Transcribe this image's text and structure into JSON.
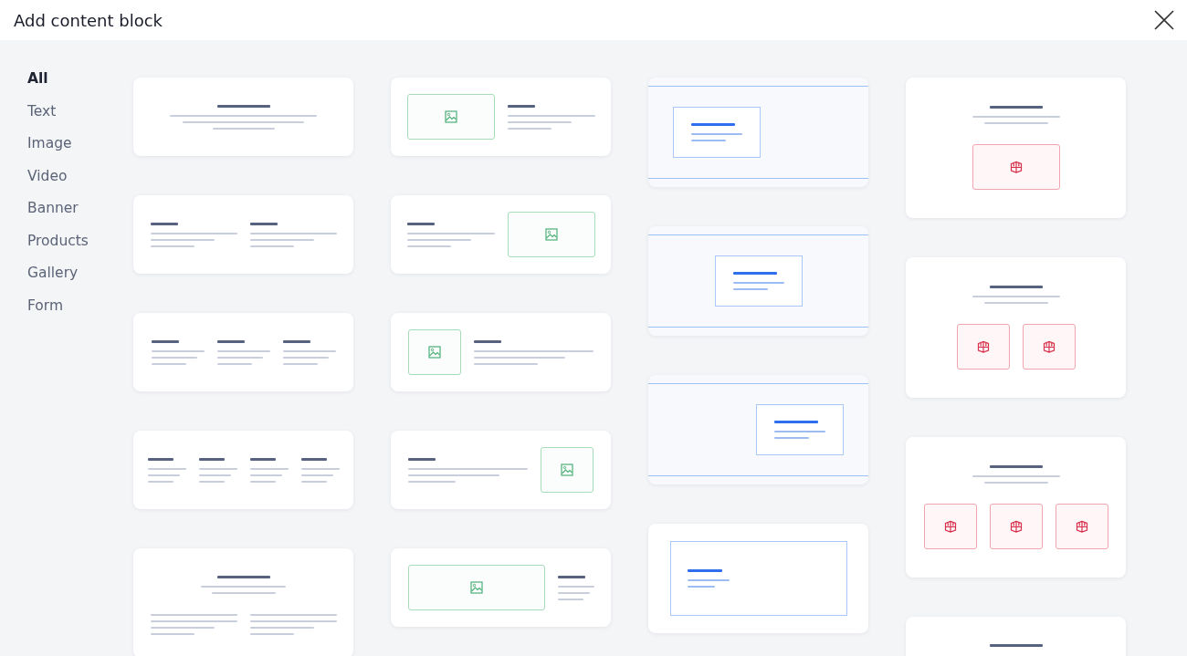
{
  "dialog": {
    "title": "Add content block"
  },
  "sidebar": {
    "items": [
      {
        "label": "All",
        "selected": true
      },
      {
        "label": "Text",
        "selected": false
      },
      {
        "label": "Image",
        "selected": false
      },
      {
        "label": "Video",
        "selected": false
      },
      {
        "label": "Banner",
        "selected": false
      },
      {
        "label": "Products",
        "selected": false
      },
      {
        "label": "Gallery",
        "selected": false
      },
      {
        "label": "Form",
        "selected": false
      }
    ]
  },
  "columns": [
    {
      "blocks": [
        {
          "kind": "centered"
        },
        {
          "kind": "columns2"
        },
        {
          "kind": "columns3"
        },
        {
          "kind": "columns4"
        },
        {
          "kind": "article"
        }
      ]
    },
    {
      "blocks": [
        {
          "kind": "imageleft"
        },
        {
          "kind": "imageright"
        },
        {
          "kind": "thumbleft"
        },
        {
          "kind": "thumbright"
        },
        {
          "kind": "imagewide"
        }
      ]
    },
    {
      "blocks": [
        {
          "kind": "bannerleft"
        },
        {
          "kind": "bannercenter"
        },
        {
          "kind": "bannerright"
        },
        {
          "kind": "bannerboxed"
        }
      ]
    },
    {
      "blocks": [
        {
          "kind": "product1"
        },
        {
          "kind": "product2"
        },
        {
          "kind": "product3"
        },
        {
          "kind": "productheading"
        }
      ]
    }
  ]
}
